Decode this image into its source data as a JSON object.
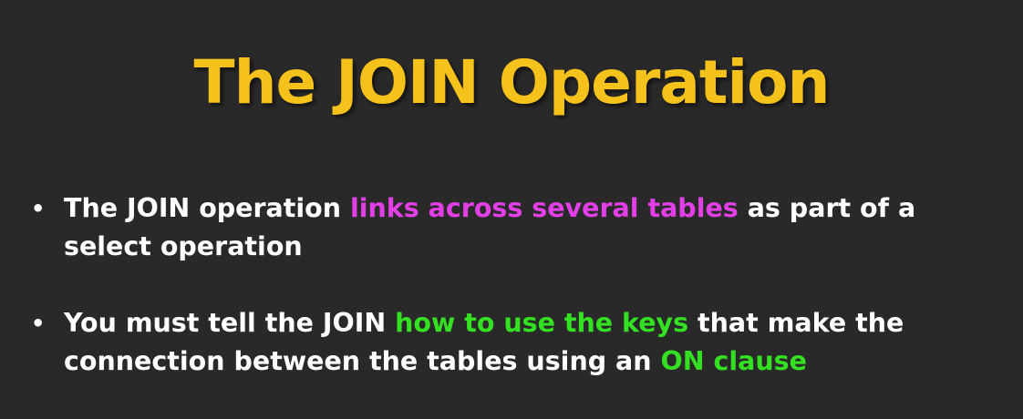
{
  "slide": {
    "title": "The JOIN Operation",
    "bullets": [
      {
        "before": "The JOIN operation ",
        "highlight": "links across several tables",
        "after": " as part of a select operation"
      },
      {
        "before": "You must tell the JOIN ",
        "highlight": "how to use the keys",
        "middle": " that make the connection between the tables using an ",
        "highlight2": "ON clause"
      }
    ],
    "bullet_symbol": "•"
  },
  "colors": {
    "background": "#2a2929",
    "title": "#f5c21b",
    "body_text": "#ffffff",
    "highlight_magenta": "#e23fe6",
    "highlight_green": "#33e022"
  }
}
